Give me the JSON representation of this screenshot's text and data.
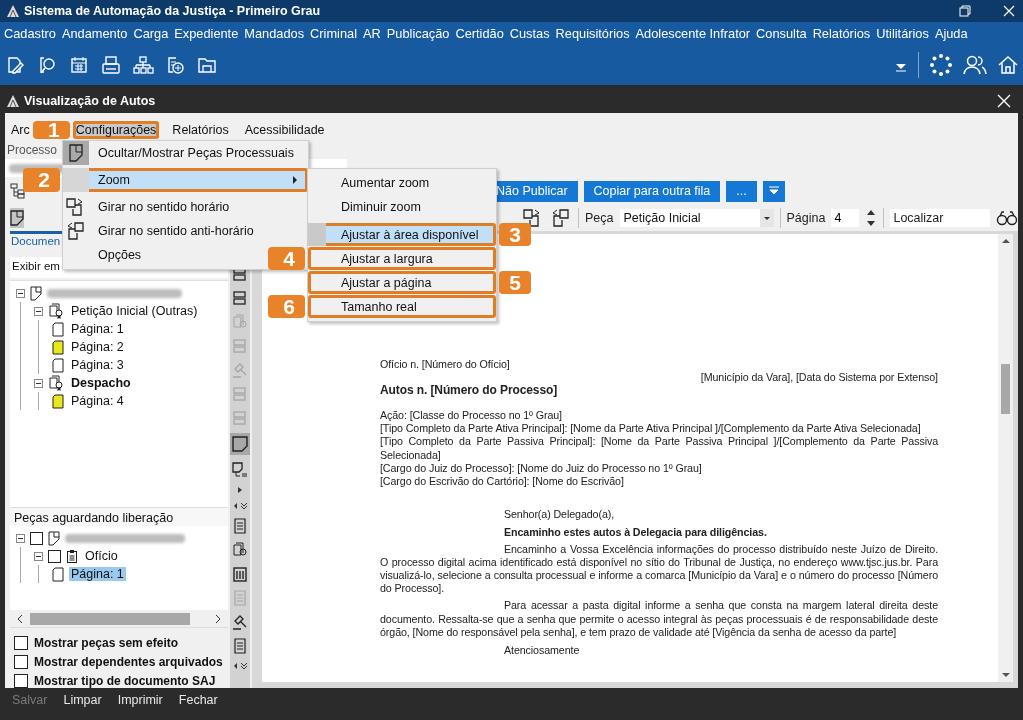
{
  "window": {
    "title": "Sistema de Automação da Justiça - Primeiro Grau"
  },
  "menu_bar": [
    "Cadastro",
    "Andamento",
    "Carga",
    "Expediente",
    "Mandados",
    "Criminal",
    "AR",
    "Publicação",
    "Certidão",
    "Custas",
    "Requisitórios",
    "Adolescente Infrator",
    "Consulta",
    "Relatórios",
    "Utilitários",
    "Ajuda"
  ],
  "dialog": {
    "title": "Visualização de Autos"
  },
  "dialog_menu": [
    {
      "label": "Arc",
      "selected": false
    },
    {
      "label": "Configurações",
      "selected": true,
      "callout": {
        "number": "1"
      }
    },
    {
      "label": "Relatórios",
      "selected": false
    },
    {
      "label": "Acessibilidade",
      "selected": false
    }
  ],
  "process": {
    "label": "Processo"
  },
  "actions": [
    "Não Publicar",
    "Copiar para outra fila",
    "..."
  ],
  "viewer_toolbar": {
    "piece_label": "Peça",
    "piece_value": "Petição Inicial",
    "page_label": "Página",
    "page_value": "4",
    "search_placeholder": "Localizar"
  },
  "documents_panel": {
    "tab": "Documen",
    "filter": "Exibir em",
    "tree": [
      {
        "expanded": true,
        "children": [
          {
            "label": "Petição Inicial (Outras)",
            "bold": false,
            "expanded": true,
            "children": [
              {
                "label": "Página: 1",
                "marked": false
              },
              {
                "label": "Página: 2",
                "marked": true
              },
              {
                "label": "Página: 3",
                "marked": false
              }
            ]
          },
          {
            "label": "Despacho",
            "bold": true,
            "expanded": true,
            "children": [
              {
                "label": "Página: 4",
                "marked": true
              }
            ]
          }
        ]
      }
    ]
  },
  "pending_panel": {
    "title": "Peças aguardando liberação",
    "tree": [
      {
        "expanded": true,
        "checked": false,
        "children": [
          {
            "label": "Ofício",
            "expanded": true,
            "checked": false,
            "children": [
              {
                "label": "Página: 1",
                "selected": true
              }
            ]
          }
        ]
      }
    ]
  },
  "options": [
    {
      "label": "Mostrar peças sem efeito",
      "checked": false
    },
    {
      "label": "Mostrar dependentes arquivados",
      "checked": false
    },
    {
      "label": "Mostrar tipo de documento SAJ",
      "checked": false
    }
  ],
  "side_tools": {
    "upper": [
      {
        "disabled": false,
        "selected": false
      },
      {
        "disabled": false,
        "selected": false
      },
      {
        "disabled": true,
        "selected": false
      },
      {
        "disabled": true,
        "selected": false
      },
      {
        "disabled": true,
        "selected": false
      },
      {
        "disabled": true,
        "selected": false
      },
      {
        "disabled": true,
        "selected": false
      },
      {
        "disabled": false,
        "selected": true
      },
      {
        "disabled": false,
        "selected": false
      }
    ],
    "lower": [
      {
        "disabled": false,
        "selected": false
      },
      {
        "disabled": false,
        "selected": false
      },
      {
        "disabled": false,
        "selected": false
      },
      {
        "disabled": true,
        "selected": false
      },
      {
        "disabled": false,
        "selected": false
      },
      {
        "disabled": false,
        "selected": false
      }
    ]
  },
  "document": [
    {
      "kind": "plain",
      "text": "Ofício n. [Número do Ofício]"
    },
    {
      "kind": "right",
      "text": "[Município da Vara], [Data do Sistema por Extenso]"
    },
    {
      "kind": "heading",
      "text": "Autos n. [Número do Processo]"
    },
    {
      "kind": "plain",
      "text": "Ação: [Classe do Processo no 1º Grau]"
    },
    {
      "kind": "plain",
      "text": "[Tipo Completo da Parte Ativa Principal]: [Nome da Parte Ativa Principal ]/[Complemento da Parte Ativa Selecionada]"
    },
    {
      "kind": "plain",
      "text": "[Tipo Completo da Parte Passiva Principal]: [Nome da Parte Passiva Principal ]/[Complemento da Parte Passiva Selecionada]"
    },
    {
      "kind": "plain",
      "text": "[Cargo do Juiz do Processo]: [Nome do Juiz do Processo no 1º Grau]"
    },
    {
      "kind": "plain",
      "text": "[Cargo do Escrivão do Cartório]: [Nome do Escrivão]"
    },
    {
      "kind": "salutation",
      "text": "Senhor(a) Delegado(a),"
    },
    {
      "kind": "emphasis",
      "text": "Encaminho estes autos à Delegacia para diligências."
    },
    {
      "kind": "paragraph",
      "text": "Encaminho a Vossa Excelência informações do processo distribuído neste Juízo de Direito. O processo digital acima identificado está disponível no sítio do Tribunal de Justiça, no endereço www.tjsc.jus.br. Para visualizá-lo, selecione a consulta processual e informe a comarca  [Município da Vara] e o número do processo [Número do Processo]."
    },
    {
      "kind": "paragraph",
      "text": "Para acessar a pasta digital informe a senha que consta na margem lateral direita deste documento. Ressalta-se que a senha que permite o acesso integral às peças processuais é de responsabilidade deste órgão, [Nome do responsável pela senha], e tem prazo de validade até [Vigência da senha de acesso da parte]"
    },
    {
      "kind": "closing",
      "text": "Atenciosamente"
    }
  ],
  "context_menu": [
    {
      "label": "Ocultar/Mostrar Peças Processuais",
      "checked": true,
      "highlighted": false
    },
    {
      "label": "Zoom",
      "checked": false,
      "highlighted": true,
      "submenu": true,
      "callout": {
        "number": "2"
      }
    },
    {
      "label": "Girar no sentido horário",
      "checked": false,
      "highlighted": false
    },
    {
      "label": "Girar no sentido anti-horário",
      "checked": false,
      "highlighted": false
    },
    {
      "label": "Opções",
      "checked": false,
      "highlighted": false
    }
  ],
  "zoom_submenu": [
    {
      "label": "Aumentar zoom",
      "highlighted": false
    },
    {
      "label": "Diminuir zoom",
      "highlighted": false
    },
    {
      "label": "Ajustar à área disponível",
      "highlighted": true,
      "callout": {
        "number": "3"
      }
    },
    {
      "label": "Ajustar a largura",
      "highlighted": false,
      "callout": {
        "number": "4"
      }
    },
    {
      "label": "Ajustar a página",
      "highlighted": false,
      "callout": {
        "number": "5"
      }
    },
    {
      "label": "Tamanho real",
      "highlighted": false,
      "callout": {
        "number": "6"
      }
    }
  ],
  "footer": [
    {
      "label": "Salvar",
      "disabled": true
    },
    {
      "label": "Limpar",
      "disabled": false
    },
    {
      "label": "Imprimir",
      "disabled": false
    },
    {
      "label": "Fechar",
      "disabled": false
    }
  ]
}
